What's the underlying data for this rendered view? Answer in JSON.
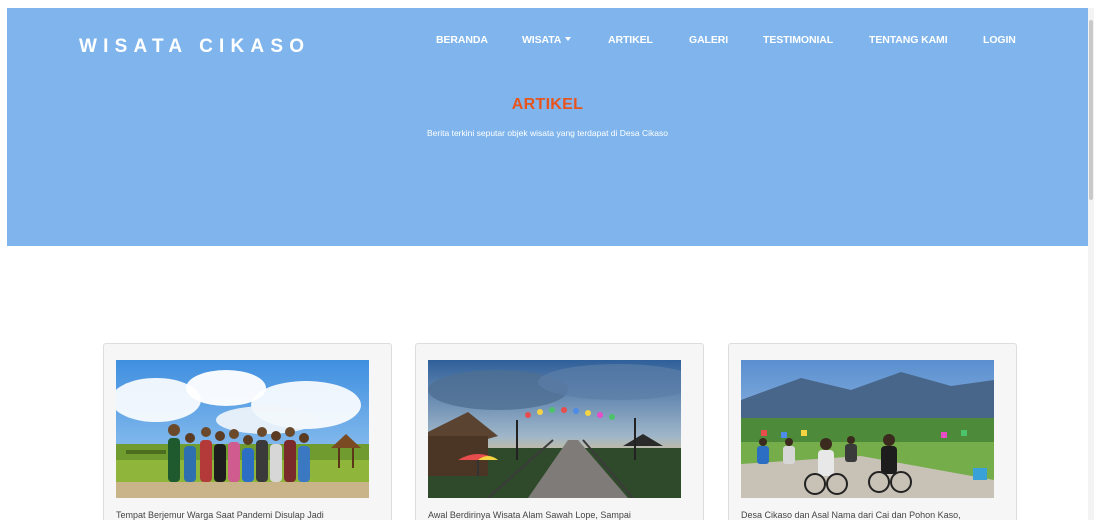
{
  "header": {
    "brand": "WISATA CIKASO",
    "nav": [
      {
        "label": "BERANDA"
      },
      {
        "label": "WISATA"
      },
      {
        "label": "ARTIKEL"
      },
      {
        "label": "GALERI"
      },
      {
        "label": "TESTIMONIAL"
      },
      {
        "label": "TENTANG KAMI"
      },
      {
        "label": "LOGIN"
      }
    ]
  },
  "hero": {
    "title": "ARTIKEL",
    "subtitle": "Berita terkini seputar objek wisata yang terdapat di Desa Cikaso"
  },
  "articles": [
    {
      "title": "Tempat Berjemur Warga Saat Pandemi Disulap Jadi",
      "image": "group photo of villagers at rice field gazebo"
    },
    {
      "title": "Awal Berdirinya Wisata Alam Sawah Lope, Sampai",
      "image": "sunset over rice field pathway with lanterns and umbrellas"
    },
    {
      "title": "Desa Cikaso dan Asal Nama dari Cai dan Pohon Kaso,",
      "image": "cyclists on village road beside green rice fields and mountain"
    }
  ],
  "colors": {
    "hero_background": "#7fb5ec",
    "hero_title": "#e8541e",
    "nav_text": "#ffffff",
    "card_background": "#f6f6f6"
  }
}
